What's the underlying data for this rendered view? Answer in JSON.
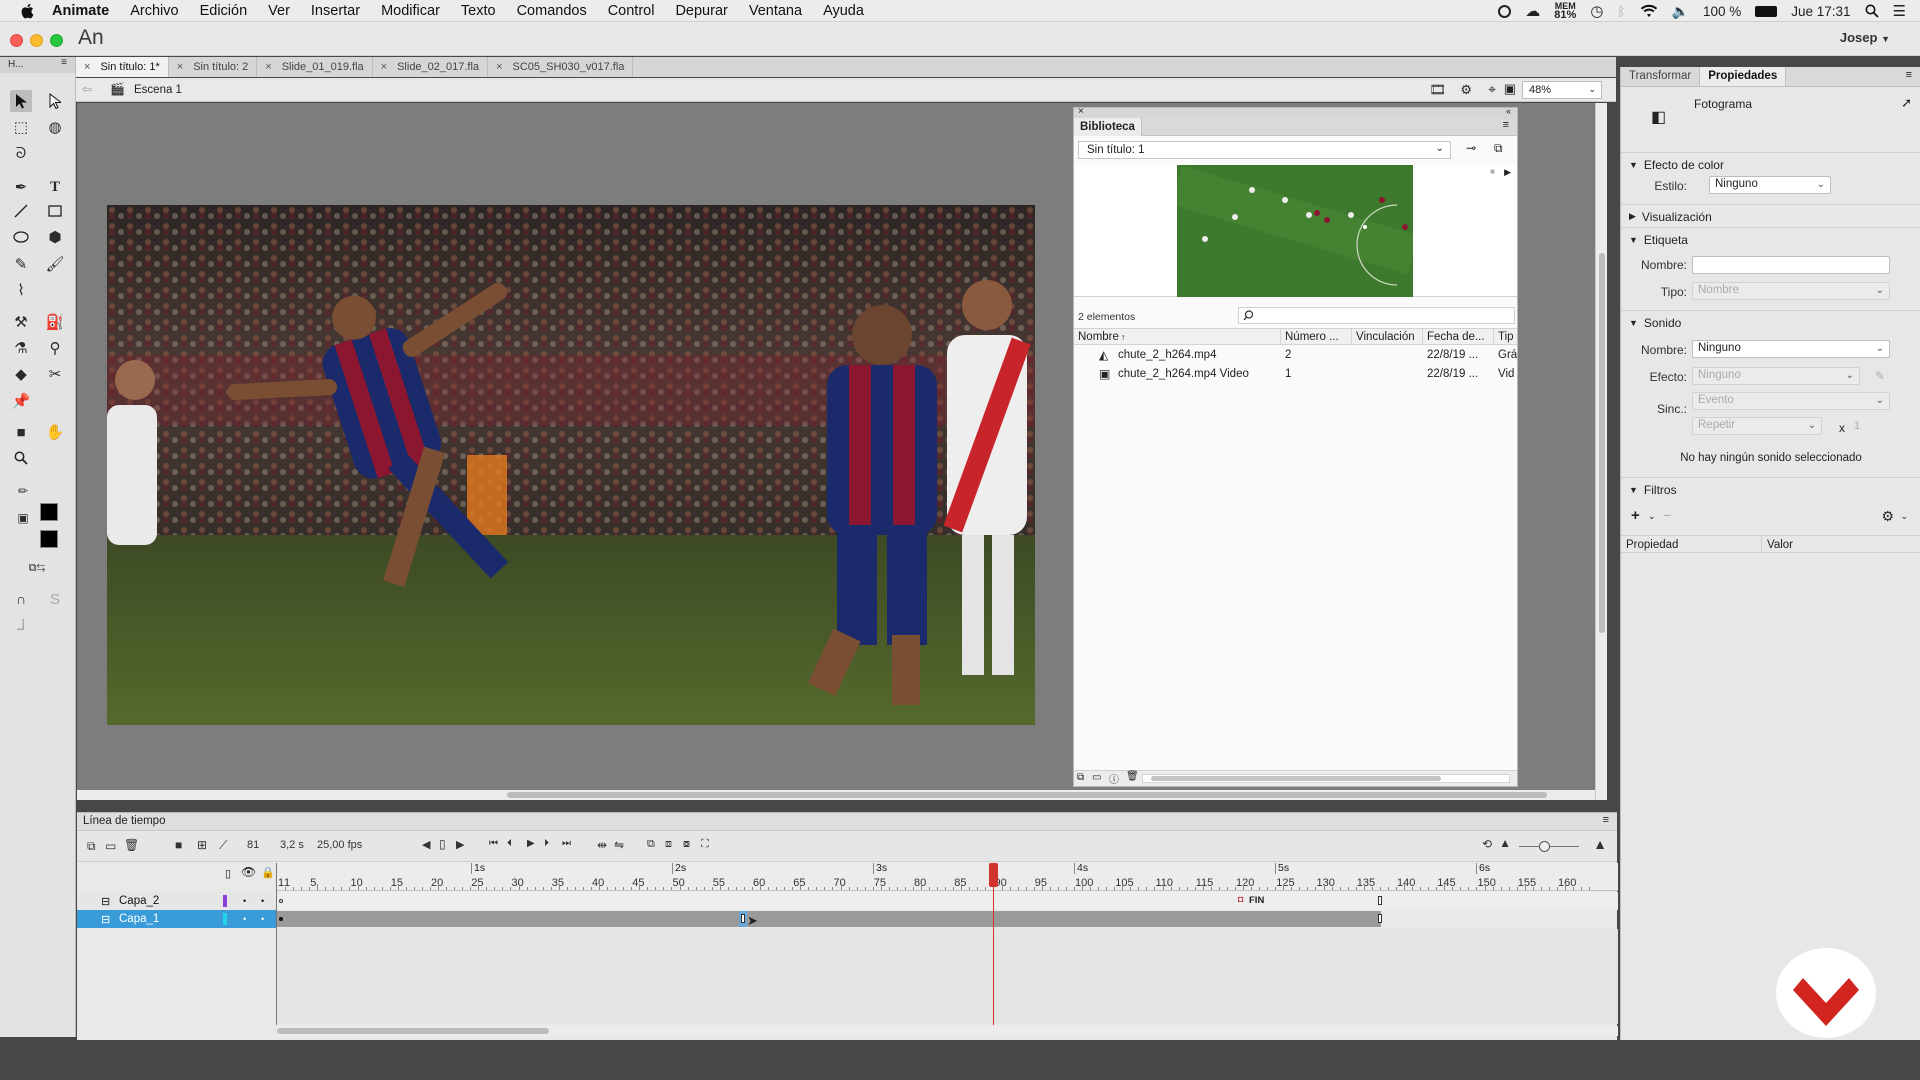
{
  "menubar": {
    "app": "Animate",
    "items": [
      "Archivo",
      "Edición",
      "Ver",
      "Insertar",
      "Modificar",
      "Texto",
      "Comandos",
      "Control",
      "Depurar",
      "Ventana",
      "Ayuda"
    ],
    "mem_top": "MEM",
    "mem_value": "81%",
    "battery": "100 %",
    "clock": "Jue 17:31"
  },
  "window": {
    "app_short": "An",
    "user": "Josep"
  },
  "tabs": [
    {
      "label": "Sin título: 1*",
      "active": true
    },
    {
      "label": "Sin título: 2",
      "active": false
    },
    {
      "label": "Slide_01_019.fla",
      "active": false
    },
    {
      "label": "Slide_02_017.fla",
      "active": false
    },
    {
      "label": "SC05_SH030_v017.fla",
      "active": false
    }
  ],
  "tools_panel_label": "H...",
  "scene": {
    "label": "Escena 1",
    "zoom": "48%"
  },
  "library": {
    "title": "Biblioteca",
    "document": "Sin título: 1",
    "count": "2 elementos",
    "columns": [
      "Nombre",
      "Número ...",
      "Vinculación",
      "Fecha de...",
      "Tip"
    ],
    "rows": [
      {
        "name": "chute_2_h264.mp4",
        "number": "2",
        "link": "",
        "date": "22/8/19 ...",
        "type": "Grá"
      },
      {
        "name": "chute_2_h264.mp4 Video",
        "number": "1",
        "link": "",
        "date": "22/8/19 ...",
        "type": "Vid"
      }
    ]
  },
  "properties": {
    "tabs": [
      "Transformar",
      "Propiedades"
    ],
    "header": "Fotograma",
    "color_effect": {
      "title": "Efecto de color",
      "style_label": "Estilo:",
      "style_value": "Ninguno"
    },
    "display": {
      "title": "Visualización"
    },
    "label": {
      "title": "Etiqueta",
      "name_label": "Nombre:",
      "name_value": "",
      "type_label": "Tipo:",
      "type_value": "Nombre"
    },
    "sound": {
      "title": "Sonido",
      "name_label": "Nombre:",
      "name_value": "Ninguno",
      "effect_label": "Efecto:",
      "effect_value": "Ninguno",
      "sync_label": "Sinc.:",
      "sync_value": "Evento",
      "repeat_value": "Repetir",
      "times_symbol": "x",
      "repeat_count": "1",
      "none_msg": "No hay ningún sonido seleccionado"
    },
    "filters": {
      "title": "Filtros",
      "col_property": "Propiedad",
      "col_value": "Valor"
    }
  },
  "timeline": {
    "title": "Línea de tiempo",
    "current_frame": "81",
    "time": "3,2 s",
    "fps": "25,00 fps",
    "second_labels": [
      "1s",
      "2s",
      "3s",
      "4s",
      "5s",
      "6s"
    ],
    "frame_numbers": [
      "1",
      "5",
      "10",
      "15",
      "20",
      "25",
      "30",
      "35",
      "40",
      "45",
      "50",
      "55",
      "60",
      "65",
      "70",
      "75",
      "80",
      "85",
      "90",
      "95",
      "100",
      "105",
      "110",
      "115",
      "120",
      "125",
      "130",
      "135",
      "140",
      "145",
      "150",
      "155",
      "160",
      "1"
    ],
    "layers": [
      {
        "name": "Capa_2",
        "color": "#8a3fd6",
        "frame_label": "FIN",
        "selected": false
      },
      {
        "name": "Capa_1",
        "color": "#23d3e6",
        "selected": true
      }
    ],
    "playhead_frame": 81
  },
  "colors": {
    "accent": "#3a9bd9",
    "playhead": "#d0342c",
    "logo": "#d2251f"
  }
}
